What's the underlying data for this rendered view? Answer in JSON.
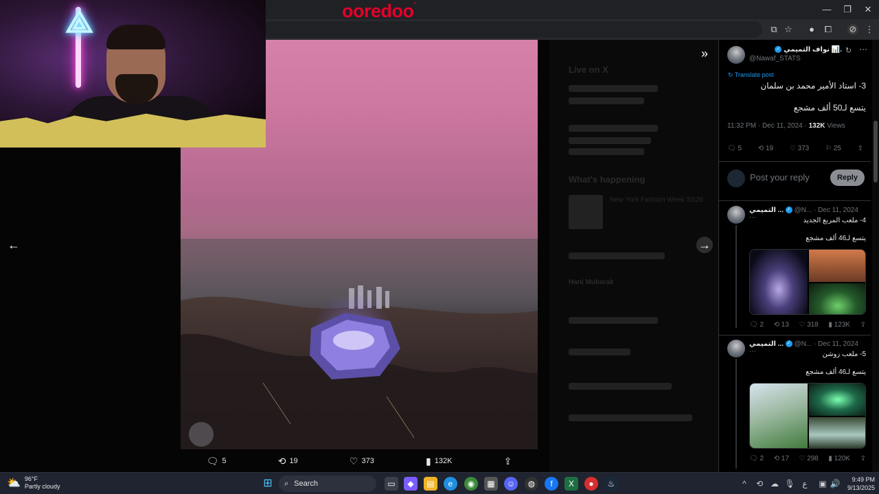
{
  "browser": {
    "brand": "ooredoo",
    "brand_mark": "°"
  },
  "media_actions": {
    "replies": "5",
    "reposts": "19",
    "likes": "373",
    "views": "132K"
  },
  "ghost_sidebar": {
    "live_heading": "Live on X",
    "happening_heading": "What's happening",
    "trend_1": "New York Fashion Week SS26",
    "trend_2": "Hani Mubarak"
  },
  "main_post": {
    "author_name": "نواف التميمي 📊.",
    "author_handle": "@Nawaf_STATS",
    "translate_label": "Translate post",
    "line1": "3- استاد الأمير محمد بن سلمان",
    "line2": "يتسع لـ50 ألف مشجع",
    "time": "11:32 PM · Dec 11, 2024 ·",
    "views_count": "132K",
    "views_label": "Views",
    "replies": "5",
    "reposts": "19",
    "likes": "373",
    "bookmarks": "25"
  },
  "reply_box": {
    "placeholder": "Post your reply",
    "button": "Reply"
  },
  "thread": [
    {
      "author": "التميمي ...",
      "handle": "@N... · Dec 11, 2024",
      "line1": "4- ملعب المربع الجديد",
      "line2": "يتسع لـ46 ألف مشجع",
      "replies": "2",
      "reposts": "13",
      "likes": "318",
      "views": "123K"
    },
    {
      "author": "التميمي ...",
      "handle": "@N... · Dec 11, 2024",
      "line1": "5- ملعب روشن",
      "line2": "يتسع لـ46 ألف مشجع",
      "replies": "2",
      "reposts": "17",
      "likes": "298",
      "views": "120K"
    }
  ],
  "taskbar": {
    "temp": "96°F",
    "weather": "Partly cloudy",
    "search": "Search",
    "time": "9:49 PM",
    "date": "9/13/2025"
  },
  "colors": {
    "accent": "#1d9bf0",
    "brand": "#e4002b"
  }
}
